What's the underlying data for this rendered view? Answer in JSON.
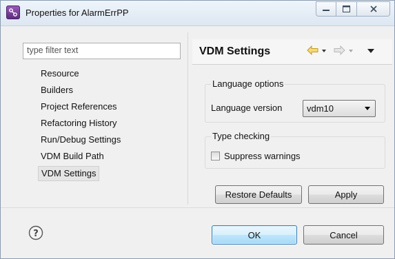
{
  "window": {
    "title": "Properties for AlarmErrPP"
  },
  "filter": {
    "placeholder": "type filter text"
  },
  "tree": {
    "items": [
      "Resource",
      "Builders",
      "Project References",
      "Refactoring History",
      "Run/Debug Settings",
      "VDM Build Path",
      "VDM Settings"
    ],
    "selected": "VDM Settings"
  },
  "page": {
    "title": "VDM Settings"
  },
  "language_options": {
    "group_title": "Language options",
    "version_label": "Language version",
    "version_value": "vdm10"
  },
  "type_checking": {
    "group_title": "Type checking",
    "suppress_label": "Suppress warnings",
    "suppress_checked": false
  },
  "buttons": {
    "restore_defaults": "Restore Defaults",
    "apply": "Apply",
    "ok": "OK",
    "cancel": "Cancel"
  },
  "icons": {
    "app": "eclipse-app-icon",
    "back": "back-arrow-icon",
    "forward": "forward-arrow-icon",
    "menu": "view-menu-icon",
    "help": "help-icon"
  },
  "colors": {
    "back_arrow": "#f0c040",
    "forward_arrow": "#c8c8c8",
    "default_button_border": "#3c7fb1"
  }
}
